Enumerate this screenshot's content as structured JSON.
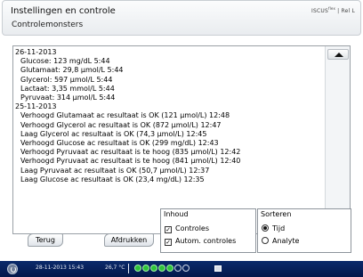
{
  "header": {
    "title": "Instellingen en controle",
    "subtitle": "Controlemonsters",
    "brand_main": "ISCUS",
    "brand_sup": "flex",
    "brand_rest": " | Rel L"
  },
  "log": {
    "lines": [
      {
        "text": "26-11-2013",
        "indent": false
      },
      {
        "text": "Glucose: 123 mg/dL 5:44",
        "indent": true
      },
      {
        "text": "Glutamaat: 29,8 µmol/L 5:44",
        "indent": true
      },
      {
        "text": "Glycerol: 597 µmol/L 5:44",
        "indent": true
      },
      {
        "text": "Lactaat: 3,35 mmol/L 5:44",
        "indent": true
      },
      {
        "text": "Pyruvaat: 314 µmol/L 5:44",
        "indent": true
      },
      {
        "text": "25-11-2013",
        "indent": false
      },
      {
        "text": "Verhoogd Glutamaat ac resultaat is OK (121 µmol/L) 12:48",
        "indent": true
      },
      {
        "text": "Verhoogd Glycerol ac resultaat is OK (872 µmol/L) 12:47",
        "indent": true
      },
      {
        "text": "Laag Glycerol ac resultaat is OK (74,3 µmol/L) 12:45",
        "indent": true
      },
      {
        "text": "Verhoogd Glucose ac resultaat is OK (299 mg/dL) 12:43",
        "indent": true
      },
      {
        "text": "Verhoogd Pyruvaat ac resultaat is te hoog (835 µmol/L) 12:42",
        "indent": true
      },
      {
        "text": "Verhoogd Pyruvaat ac resultaat is te hoog (841 µmol/L) 12:40",
        "indent": true
      },
      {
        "text": "Laag Pyruvaat ac resultaat is OK (50,7 µmol/L) 12:37",
        "indent": true
      },
      {
        "text": "Laag Glucose ac resultaat is OK (23,4 mg/dL) 12:35",
        "indent": true
      }
    ]
  },
  "inhoud": {
    "title": "Inhoud",
    "options": [
      {
        "label": "Controles",
        "checked": true
      },
      {
        "label": "Autom. controles",
        "checked": true
      }
    ]
  },
  "sorteren": {
    "title": "Sorteren",
    "options": [
      {
        "label": "Tijd",
        "selected": true
      },
      {
        "label": "Analyte",
        "selected": false
      }
    ]
  },
  "buttons": {
    "terug": "Terug",
    "afdrukken": "Afdrukken"
  },
  "status": {
    "datetime": "28-11-2013 15:43",
    "temperature": "26,7 °C",
    "green_dots": 5,
    "empty_dots": 2
  },
  "icons": [
    "power-icon",
    "scroll-up-icon",
    "scroll-down-icon",
    "checkbox-icon",
    "radio-icon",
    "status-dot-icon"
  ],
  "colors": {
    "statusbar": "#04184a",
    "status_green": "#2ec33a"
  }
}
